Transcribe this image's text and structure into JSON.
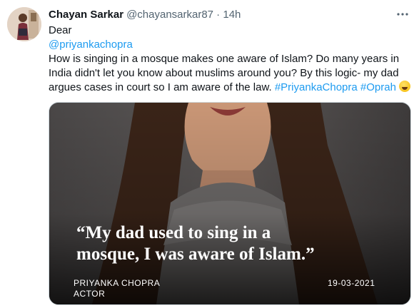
{
  "tweet": {
    "author_name": "Chayan Sarkar",
    "author_handle": "@chayansarkar87 · 14h",
    "more_icon": "more-horizontal-icon",
    "line1": "Dear",
    "mention": "@priyankachopra",
    "body": "How is singing in a mosque makes one aware of Islam? Do many years in India didn't let you know about muslims around you? By this logic- my dad argues cases in court so I am aware of the law.",
    "hashtag1": "#PriyankaChopra",
    "hashtag2": "#Oprah",
    "emoji": "face-with-tears-of-joy"
  },
  "media": {
    "quote_line1": "“My dad used to sing in a",
    "quote_line2": "mosque, I was aware of Islam.”",
    "person_name": "PRIYANKA CHOPRA",
    "person_role": "ACTOR",
    "date": "19-03-2021"
  },
  "colors": {
    "link": "#1d9bf0",
    "text": "#0f1419",
    "muted": "#536471"
  }
}
